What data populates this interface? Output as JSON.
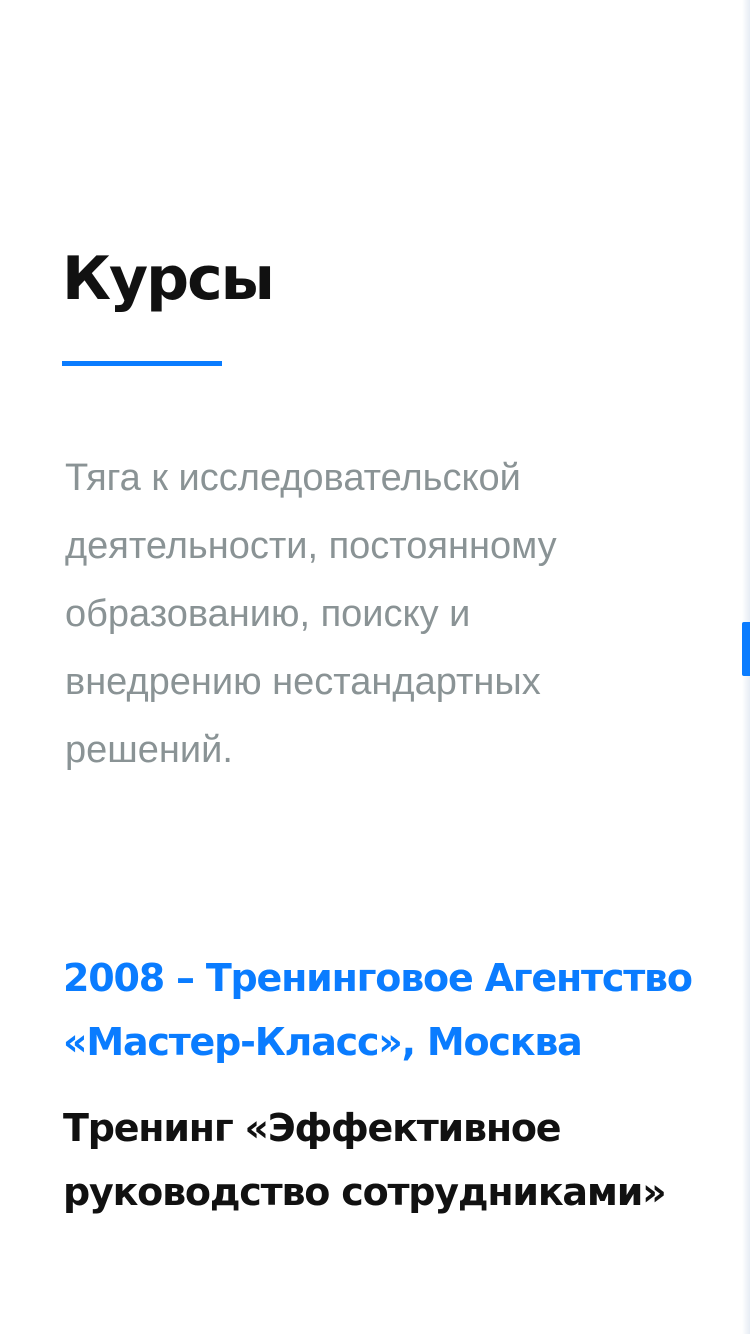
{
  "courses": {
    "title": "Курсы",
    "description": "Тяга к исследовательской деятельности, постоянному образованию, поиску и внедрению нестандартных решений.",
    "items": [
      {
        "org": "2008 – Тренинговое Агентство «Мастер-Класс», Москва",
        "name": "Тренинг «Эффективное руководство сотрудниками»"
      }
    ]
  },
  "colors": {
    "accent": "#0a7cff",
    "heading": "#111111",
    "body_text": "#8a9395",
    "background": "#ffffff"
  }
}
